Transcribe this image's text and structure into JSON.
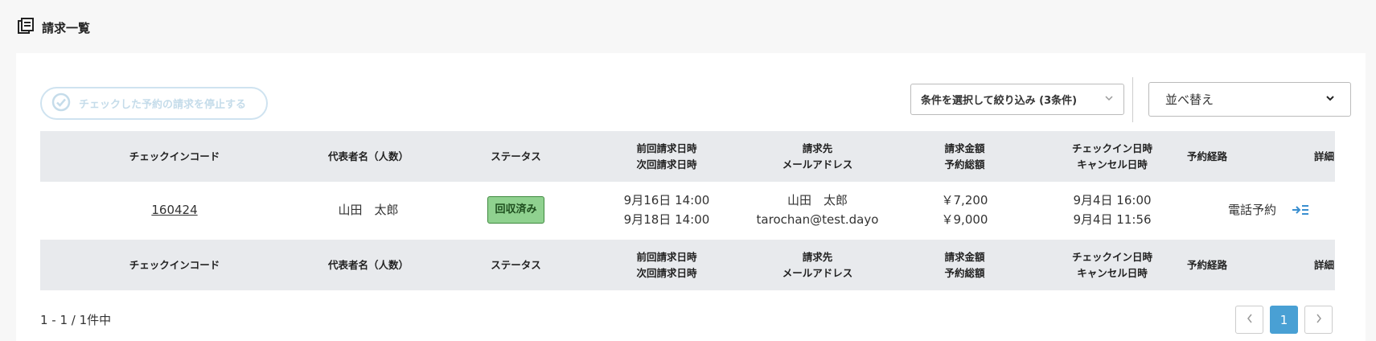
{
  "header": {
    "title": "請求一覧"
  },
  "toolbar": {
    "stop_button_label": "チェックした予約の請求を停止する",
    "filter_label": "条件を選択して絞り込み (3条件)",
    "sort_label": "並べ替え"
  },
  "table": {
    "columns": [
      {
        "line1": "チェックインコード",
        "line2": ""
      },
      {
        "line1": "代表者名（人数）",
        "line2": ""
      },
      {
        "line1": "ステータス",
        "line2": ""
      },
      {
        "line1": "前回請求日時",
        "line2": "次回請求日時"
      },
      {
        "line1": "請求先",
        "line2": "メールアドレス"
      },
      {
        "line1": "請求金額",
        "line2": "予約総額"
      },
      {
        "line1": "チェックイン日時",
        "line2": "キャンセル日時"
      },
      {
        "line1": "予約経路",
        "line2": ""
      },
      {
        "line1": "詳細",
        "line2": ""
      }
    ],
    "rows": [
      {
        "checkin_code": "160424",
        "representative": "山田　太郎",
        "status": "回収済み",
        "last_billing": "9月16日 14:00",
        "next_billing": "9月18日 14:00",
        "billing_name": "山田　太郎",
        "billing_email": "tarochan@test.dayo",
        "billing_amount": "￥7,200",
        "total_amount": "￥9,000",
        "checkin_datetime": "9月4日 16:00",
        "cancel_datetime": "9月4日 11:56",
        "route": "電話予約"
      }
    ]
  },
  "footer": {
    "count_text": "1 - 1 / 1件中",
    "current_page": "1"
  },
  "colors": {
    "accent": "#49a0d4",
    "status_green": "#8fd18f",
    "header_bg": "#e8eaed"
  },
  "icons": {
    "title_icon": "list-book-icon",
    "stop_icon": "check-circle-icon",
    "filter_chevron": "chevron-down-icon",
    "sort_chevron": "chevron-down-icon",
    "detail_icon": "arrow-right-list-icon",
    "prev_icon": "chevron-left-icon",
    "next_icon": "chevron-right-icon"
  }
}
